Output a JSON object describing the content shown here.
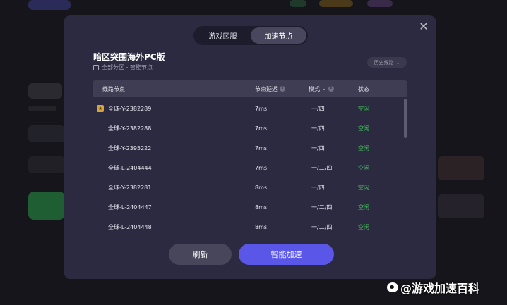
{
  "modal": {
    "tabs": [
      {
        "label": "游戏区服",
        "active": false
      },
      {
        "label": "加速节点",
        "active": true
      }
    ],
    "close_icon": "✕",
    "game_title": "暗区突围海外PC版",
    "game_sub": "全部分区 - 智能节点",
    "history_label": "历史线路",
    "table": {
      "headers": {
        "node": "线路节点",
        "latency": "节点延迟",
        "mode": "模式",
        "status": "状态"
      },
      "rows": [
        {
          "node": "全球-Y-2382289",
          "latency": "7ms",
          "mode": "一/四",
          "status": "空闲",
          "favorite": true
        },
        {
          "node": "全球-Y-2382288",
          "latency": "7ms",
          "mode": "一/四",
          "status": "空闲",
          "favorite": false
        },
        {
          "node": "全球-Y-2395222",
          "latency": "7ms",
          "mode": "一/四",
          "status": "空闲",
          "favorite": false
        },
        {
          "node": "全球-L-2404444",
          "latency": "7ms",
          "mode": "一/二/四",
          "status": "空闲",
          "favorite": false
        },
        {
          "node": "全球-Y-2382281",
          "latency": "8ms",
          "mode": "一/四",
          "status": "空闲",
          "favorite": false
        },
        {
          "node": "全球-L-2404447",
          "latency": "8ms",
          "mode": "一/二/四",
          "status": "空闲",
          "favorite": false
        },
        {
          "node": "全球-L-2404448",
          "latency": "8ms",
          "mode": "一/二/四",
          "status": "空闲",
          "favorite": false
        }
      ]
    },
    "refresh_label": "刷新",
    "accelerate_label": "智能加速"
  },
  "watermark": "@游戏加速百科",
  "colors": {
    "accent": "#5a57e8",
    "status_idle": "#47c45c",
    "modal_bg": "#2b2a40"
  }
}
